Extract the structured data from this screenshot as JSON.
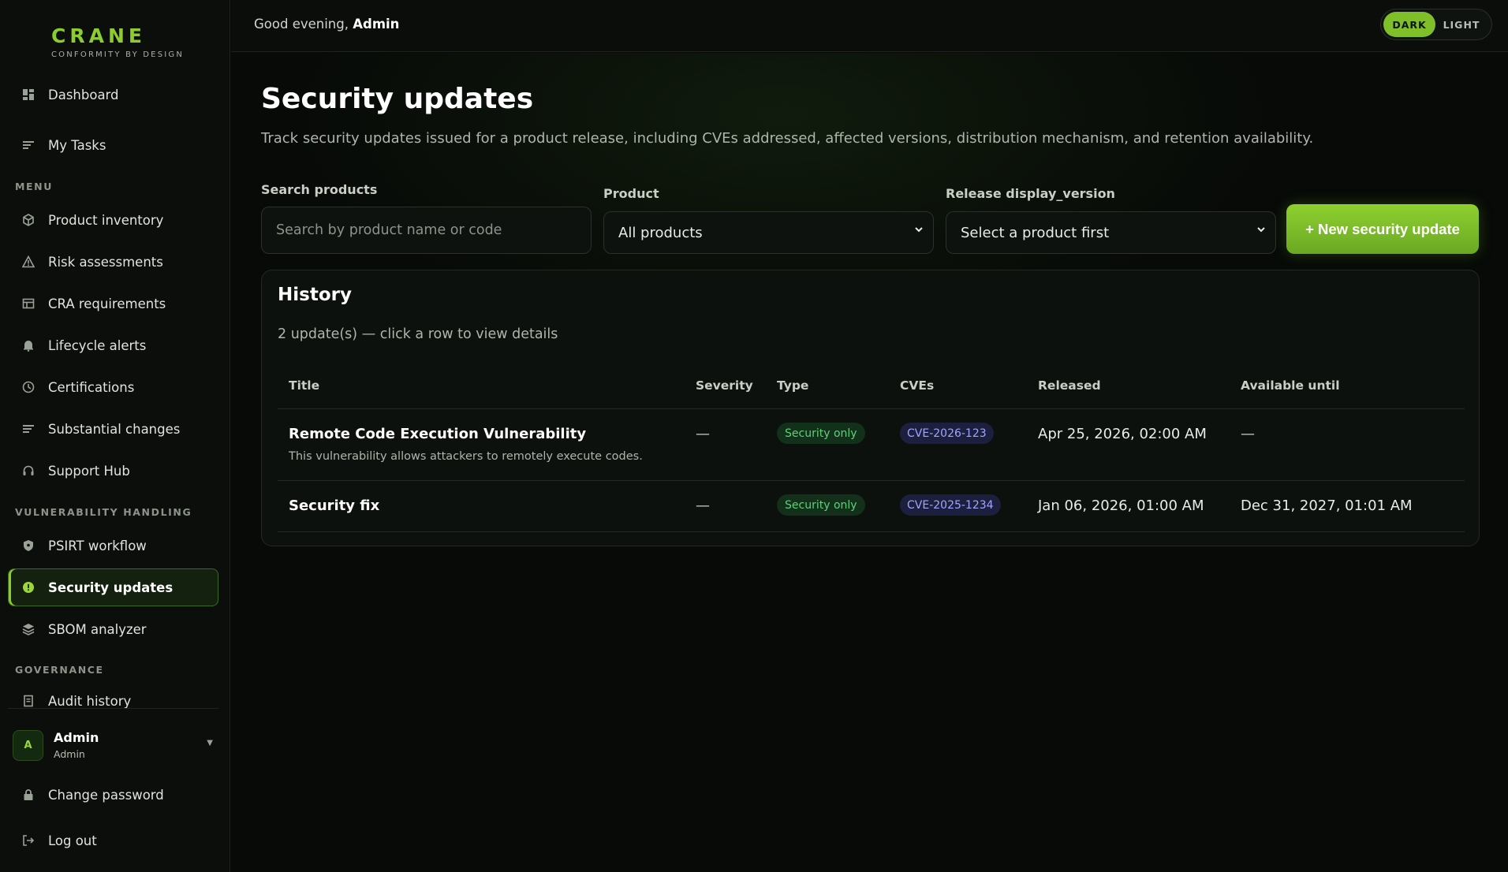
{
  "brand": {
    "name": "CRANE",
    "tagline": "CONFORMITY BY DESIGN",
    "accent": "#8ccc2e"
  },
  "topbar": {
    "greeting_prefix": "Good evening,",
    "user": "Admin",
    "theme_dark": "DARK",
    "theme_light": "LIGHT",
    "theme_selected": "DARK"
  },
  "sidebar": {
    "top_items": [
      {
        "label": "Dashboard",
        "icon": "dashboard-icon"
      },
      {
        "label": "My Tasks",
        "icon": "tasks-icon"
      }
    ],
    "sections": {
      "menu": "MENU",
      "vulnerability": "VULNERABILITY HANDLING",
      "governance": "GOVERNANCE"
    },
    "menu_items": [
      {
        "label": "Product inventory",
        "icon": "cube-icon"
      },
      {
        "label": "Risk assessments",
        "icon": "warning-icon"
      },
      {
        "label": "CRA requirements",
        "icon": "table-icon"
      },
      {
        "label": "Lifecycle alerts",
        "icon": "bell-icon"
      },
      {
        "label": "Certifications",
        "icon": "clock-icon"
      },
      {
        "label": "Substantial changes",
        "icon": "list-icon"
      },
      {
        "label": "Support Hub",
        "icon": "headset-icon"
      }
    ],
    "vuln_items": [
      {
        "label": "PSIRT workflow",
        "icon": "shield-icon"
      },
      {
        "label": "Security updates",
        "icon": "alert-circle-icon",
        "active": true
      },
      {
        "label": "SBOM analyzer",
        "icon": "layers-icon"
      }
    ],
    "governance_items": [
      {
        "label": "Audit history",
        "icon": "document-icon"
      }
    ],
    "user": {
      "initial": "A",
      "name": "Admin",
      "role": "Admin"
    },
    "bottom_items": [
      {
        "label": "Change password",
        "icon": "lock-icon"
      },
      {
        "label": "Log out",
        "icon": "logout-icon"
      }
    ]
  },
  "page": {
    "title": "Security updates",
    "description": "Track security updates issued for a product release, including CVEs addressed, affected versions, distribution mechanism, and retention availability."
  },
  "filters": {
    "search_label": "Search products",
    "search_placeholder": "Search by product name or code",
    "search_value": "",
    "product_label": "Product",
    "product_value": "All products",
    "release_label": "Release display_version",
    "release_value": "Select a product first",
    "new_button": "+ New security update"
  },
  "history": {
    "title": "History",
    "subtitle": "2 update(s) — click a row to view details",
    "columns": [
      "Title",
      "Severity",
      "Type",
      "CVEs",
      "Released",
      "Available until"
    ],
    "rows": [
      {
        "title": "Remote Code Execution Vulnerability",
        "description": "This vulnerability allows attackers to remotely execute codes.",
        "severity": "—",
        "type": "Security only",
        "cve": "CVE-2026-123",
        "released": "Apr 25, 2026, 02:00 AM",
        "available_until": "—"
      },
      {
        "title": "Security fix",
        "description": "",
        "severity": "—",
        "type": "Security only",
        "cve": "CVE-2025-1234",
        "released": "Jan 06, 2026, 01:00 AM",
        "available_until": "Dec 31, 2027, 01:01 AM"
      }
    ]
  }
}
